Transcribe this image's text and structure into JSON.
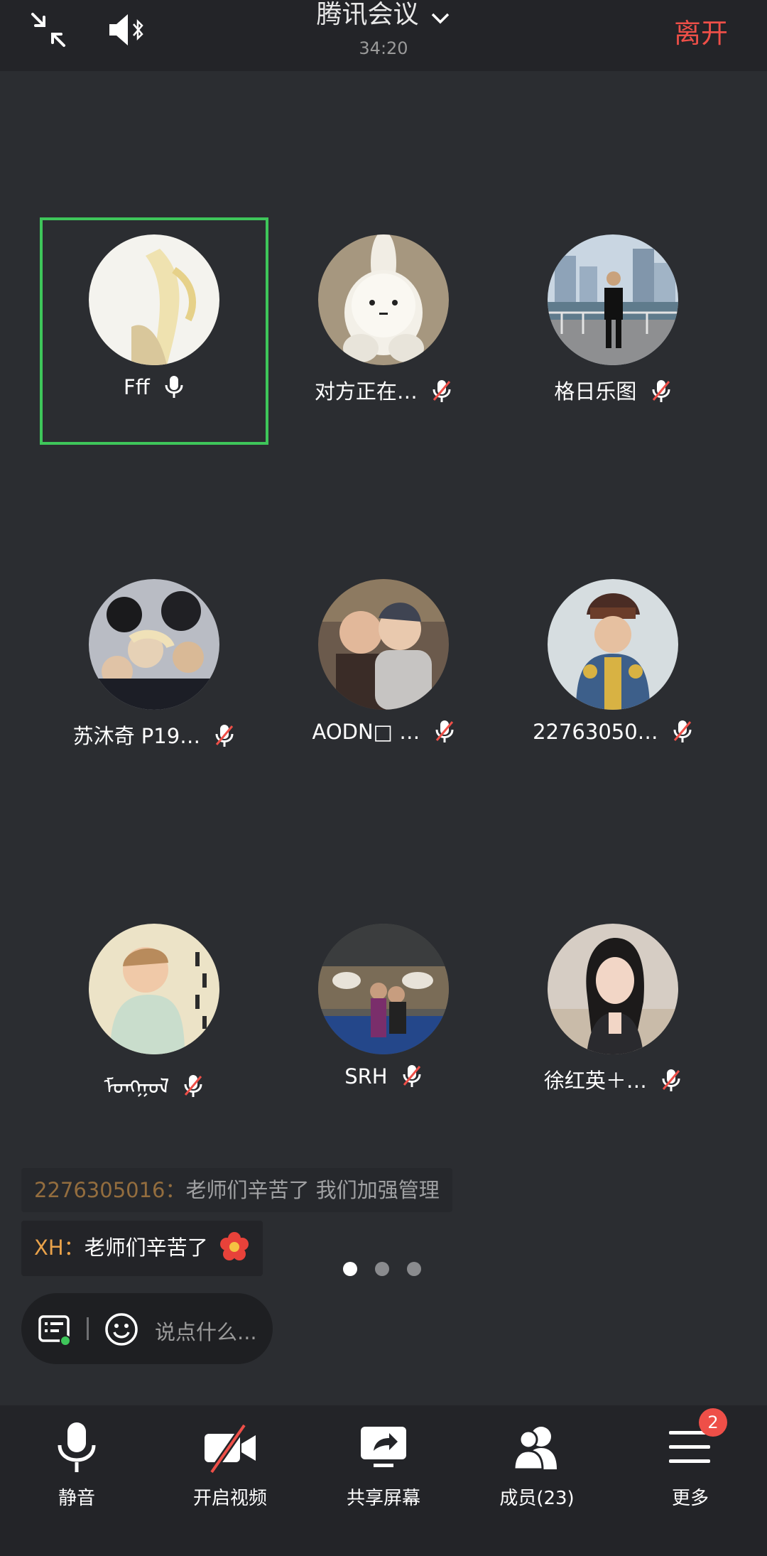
{
  "header": {
    "title": "腾讯会议",
    "timer": "34:20",
    "leave_label": "离开",
    "icons": [
      "minimize-icon",
      "bluetooth-speaker-icon",
      "chevron-down-icon"
    ]
  },
  "participants": [
    {
      "name": "Fff",
      "mic": "on",
      "active": true
    },
    {
      "name": "对方正在…",
      "mic": "muted"
    },
    {
      "name": "格日乐图",
      "mic": "muted"
    },
    {
      "name": "苏沐奇 P19…",
      "mic": "muted"
    },
    {
      "name": "AODN□ …",
      "mic": "muted"
    },
    {
      "name": "22763050…",
      "mic": "muted"
    },
    {
      "name": "ᠮᠣᠩᠭᠣᠯ",
      "mic": "muted"
    },
    {
      "name": "SRH",
      "mic": "muted"
    },
    {
      "name": "徐红英＋…",
      "mic": "muted"
    }
  ],
  "chat": [
    {
      "sender": "2276305016：",
      "text": "老师们辛苦了 我们加强管理"
    },
    {
      "sender": "XH：",
      "text": "老师们辛苦了"
    }
  ],
  "pager": {
    "pages": 3,
    "current": 1
  },
  "input": {
    "placeholder": "说点什么..."
  },
  "toolbar": {
    "items": [
      {
        "label": "静音",
        "icon": "microphone-icon"
      },
      {
        "label": "开启视频",
        "icon": "video-off-icon"
      },
      {
        "label": "共享屏幕",
        "icon": "share-screen-icon"
      },
      {
        "label": "成员(23)",
        "icon": "members-icon"
      },
      {
        "label": "更多",
        "icon": "menu-icon",
        "badge": "2"
      }
    ]
  },
  "colors": {
    "background": "#2b2d31",
    "bar": "#232428",
    "leave": "#ee4f48",
    "active_border": "#3ec65a",
    "chat_sender": "#e9a24a"
  }
}
